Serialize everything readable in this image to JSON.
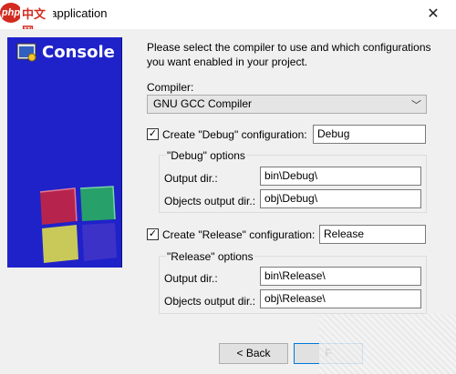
{
  "window": {
    "title": "Console application",
    "close_glyph": "✕",
    "watermark_logo": "php 中文网"
  },
  "banner": {
    "title": "Console",
    "icon": "console-app-icon",
    "colors": {
      "background": "#1f22c9",
      "cube_red": "#b6244e",
      "cube_green": "#27a06a",
      "cube_yellow": "#c9c95a",
      "cube_purple": "#3c32c8"
    }
  },
  "form": {
    "intro": "Please select the compiler to use and which configurations you want enabled in your project.",
    "compiler_label": "Compiler:",
    "compiler_value": "GNU GCC Compiler",
    "debug": {
      "checkbox_label": "Create \"Debug\" configuration:",
      "checked": true,
      "name_value": "Debug",
      "options_label": "\"Debug\" options",
      "output_dir_label": "Output dir.:",
      "output_dir_value": "bin\\Debug\\",
      "objects_dir_label": "Objects output dir.:",
      "objects_dir_value": "obj\\Debug\\"
    },
    "release": {
      "checkbox_label": "Create \"Release\" configuration:",
      "checked": true,
      "name_value": "Release",
      "options_label": "\"Release\" options",
      "output_dir_label": "Output dir.:",
      "output_dir_value": "bin\\Release\\",
      "objects_dir_label": "Objects output dir.:",
      "objects_dir_value": "obj\\Release\\"
    }
  },
  "buttons": {
    "back": "< Back",
    "next_partial": "F"
  }
}
